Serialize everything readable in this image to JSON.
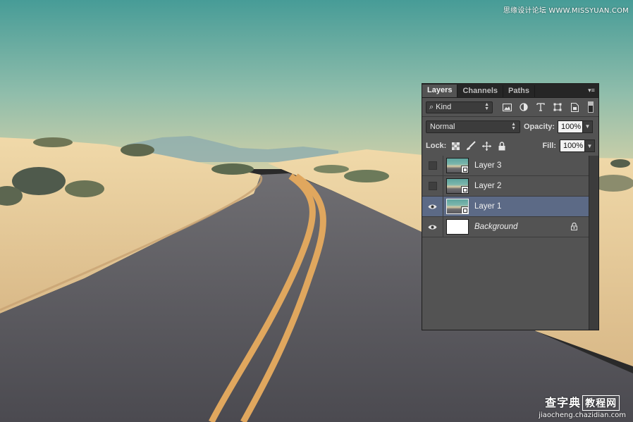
{
  "watermarks": {
    "top": "思缘设计论坛 WWW.MISSYUAN.COM",
    "bottom_main": "查字典",
    "bottom_boxed": "教程网",
    "bottom_url": "jiaocheng.chazidian.com"
  },
  "panel": {
    "tabs": [
      {
        "label": "Layers",
        "active": true
      },
      {
        "label": "Channels",
        "active": false
      },
      {
        "label": "Paths",
        "active": false
      }
    ],
    "menu_icon": "panel-menu-icon",
    "filter": {
      "kind_label": "Kind",
      "icons": [
        "image-filter-icon",
        "adjustment-filter-icon",
        "type-filter-icon",
        "shape-filter-icon",
        "smart-object-filter-icon"
      ]
    },
    "blend_mode": "Normal",
    "opacity_label": "Opacity:",
    "opacity_value": "100%",
    "lock_label": "Lock:",
    "fill_label": "Fill:",
    "fill_value": "100%",
    "lock_icons": [
      "lock-transparent-icon",
      "lock-image-icon",
      "lock-position-icon",
      "lock-all-icon"
    ],
    "layers": [
      {
        "name": "Layer 3",
        "visible": false,
        "selected": false,
        "thumb": "photo",
        "smart": true
      },
      {
        "name": "Layer 2",
        "visible": false,
        "selected": false,
        "thumb": "photo",
        "smart": true
      },
      {
        "name": "Layer 1",
        "visible": true,
        "selected": true,
        "thumb": "photo",
        "smart": true
      },
      {
        "name": "Background",
        "visible": true,
        "selected": false,
        "thumb": "white",
        "smart": false,
        "locked": true
      }
    ]
  },
  "colors": {
    "panel_bg": "#535353",
    "selected_row": "#5c6a86",
    "sky_top": "#4a9e9a",
    "sand": "#ecd3a2",
    "road": "#5b5a5e",
    "road_line": "#e0a75e"
  }
}
